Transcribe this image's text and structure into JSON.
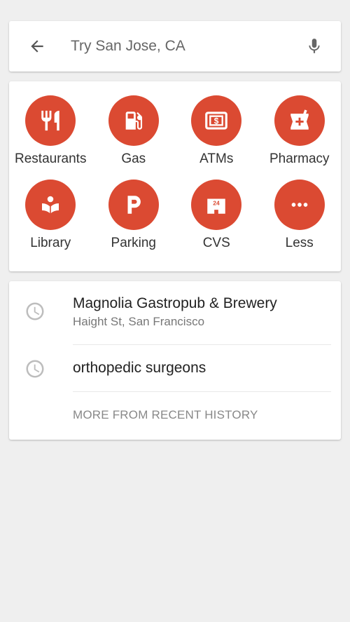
{
  "search": {
    "placeholder": "Try San Jose, CA",
    "back_icon": "arrow-back-icon",
    "mic_icon": "mic-icon"
  },
  "categories": [
    {
      "label": "Restaurants",
      "icon": "fork-knife-icon"
    },
    {
      "label": "Gas",
      "icon": "gas-pump-icon"
    },
    {
      "label": "ATMs",
      "icon": "atm-cash-icon"
    },
    {
      "label": "Pharmacy",
      "icon": "pharmacy-mortar-icon"
    },
    {
      "label": "Library",
      "icon": "book-reader-icon"
    },
    {
      "label": "Parking",
      "icon": "parking-p-icon"
    },
    {
      "label": "CVS",
      "icon": "store-24-icon"
    },
    {
      "label": "Less",
      "icon": "more-dots-icon"
    }
  ],
  "history": {
    "items": [
      {
        "title": "Magnolia Gastropub & Brewery",
        "subtitle": "Haight St, San Francisco",
        "icon": "clock-icon"
      },
      {
        "title": "orthopedic surgeons",
        "subtitle": "",
        "icon": "clock-icon"
      }
    ],
    "more_label": "MORE FROM RECENT HISTORY"
  },
  "colors": {
    "accent": "#db4a32",
    "background": "#efefef",
    "card": "#ffffff",
    "icon_gray": "#666666"
  }
}
